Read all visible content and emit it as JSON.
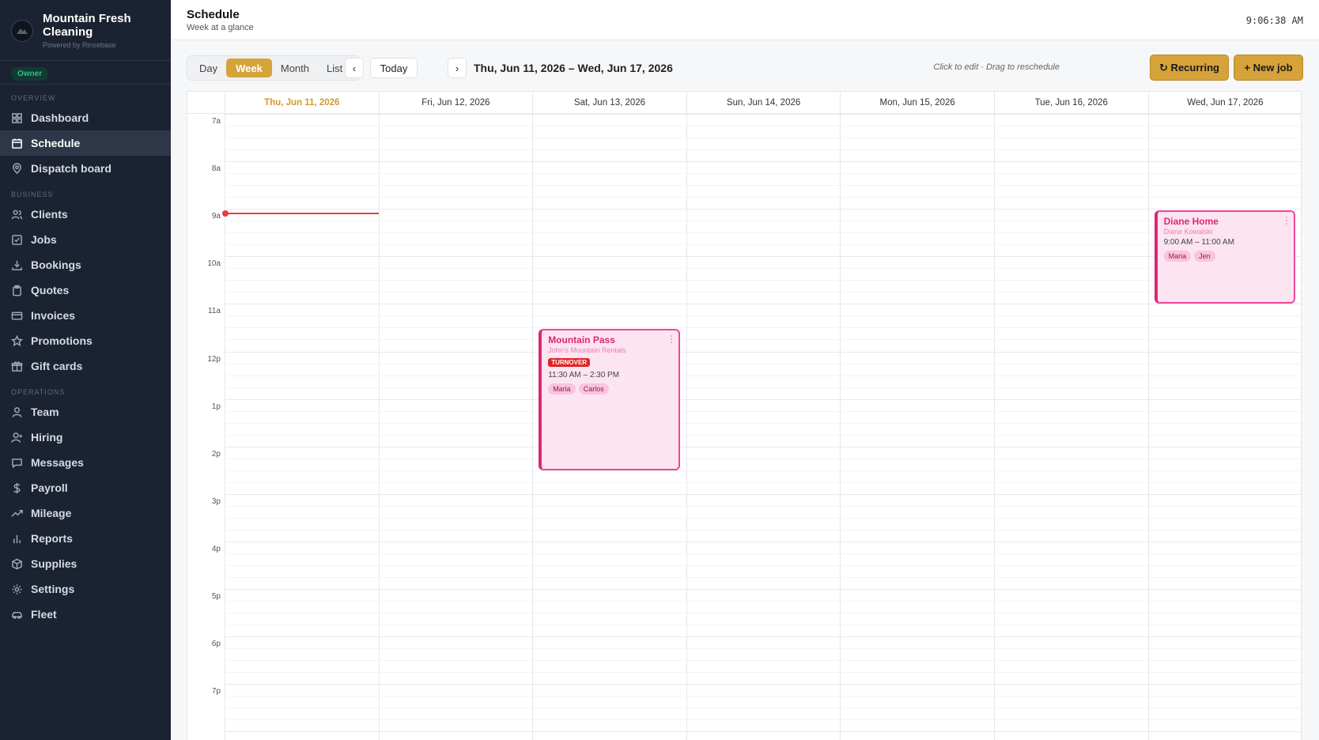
{
  "brand": {
    "name_line1": "Mountain Fresh",
    "name_line2": "Cleaning",
    "powered": "Powered by Rinsebase",
    "role": "Owner"
  },
  "sidebar": {
    "overview_label": "OVERVIEW",
    "business_label": "BUSINESS",
    "operations_label": "OPERATIONS",
    "overview": [
      {
        "label": "Dashboard",
        "icon": "grid-icon"
      },
      {
        "label": "Schedule",
        "icon": "calendar-icon",
        "active": true
      },
      {
        "label": "Dispatch board",
        "icon": "map-pin-icon"
      }
    ],
    "business": [
      {
        "label": "Clients",
        "icon": "users-icon"
      },
      {
        "label": "Jobs",
        "icon": "check-square-icon"
      },
      {
        "label": "Bookings",
        "icon": "download-icon"
      },
      {
        "label": "Quotes",
        "icon": "clipboard-icon"
      },
      {
        "label": "Invoices",
        "icon": "credit-card-icon"
      },
      {
        "label": "Promotions",
        "icon": "star-icon"
      },
      {
        "label": "Gift cards",
        "icon": "gift-icon"
      }
    ],
    "operations": [
      {
        "label": "Team",
        "icon": "user-icon"
      },
      {
        "label": "Hiring",
        "icon": "user-plus-icon"
      },
      {
        "label": "Messages",
        "icon": "message-icon"
      },
      {
        "label": "Payroll",
        "icon": "dollar-icon"
      },
      {
        "label": "Mileage",
        "icon": "trending-up-icon"
      },
      {
        "label": "Reports",
        "icon": "bar-chart-icon"
      },
      {
        "label": "Supplies",
        "icon": "box-icon"
      },
      {
        "label": "Settings",
        "icon": "gear-icon"
      },
      {
        "label": "Fleet",
        "icon": "car-icon"
      }
    ]
  },
  "header": {
    "title": "Schedule",
    "subtitle": "Week at a glance",
    "clock": "9:06:38 AM"
  },
  "toolbar": {
    "views": [
      "Day",
      "Week",
      "Month",
      "List"
    ],
    "active_view": "Week",
    "prev": "‹",
    "today": "Today",
    "next": "›",
    "range": "Thu, Jun 11, 2026 – Wed, Jun 17, 2026",
    "hint": "Click to edit · Drag to reschedule",
    "recurring": "↻ Recurring",
    "new_job": "+ New job"
  },
  "calendar": {
    "days": [
      {
        "label": "Thu, Jun 11, 2026",
        "today": true
      },
      {
        "label": "Fri, Jun 12, 2026"
      },
      {
        "label": "Sat, Jun 13, 2026"
      },
      {
        "label": "Sun, Jun 14, 2026"
      },
      {
        "label": "Mon, Jun 15, 2026"
      },
      {
        "label": "Tue, Jun 16, 2026"
      },
      {
        "label": "Wed, Jun 17, 2026"
      }
    ],
    "hours": [
      "7a",
      "8a",
      "9a",
      "10a",
      "11a",
      "12p",
      "1p",
      "2p",
      "3p",
      "4p",
      "5p",
      "6p",
      "7p"
    ],
    "now_time": "9:06",
    "events": [
      {
        "title": "Mountain Pass",
        "client": "John's Mountain Rentals",
        "tag": "TURNOVER",
        "time": "11:30 AM – 2:30 PM",
        "staff": [
          "Maria",
          "Carlos"
        ],
        "day": 2,
        "start": 11.5,
        "end": 14.5
      },
      {
        "title": "Diane Home",
        "client": "Diane Kowalski",
        "tag": "",
        "time": "9:00 AM – 11:00 AM",
        "staff": [
          "Maria",
          "Jen"
        ],
        "day": 6,
        "start": 9.0,
        "end": 11.0
      }
    ]
  },
  "colors": {
    "accent": "#d6a33a",
    "sidebar_bg": "#1b2332",
    "event_pink": "#ec4899",
    "now_red": "#e53e3e"
  }
}
